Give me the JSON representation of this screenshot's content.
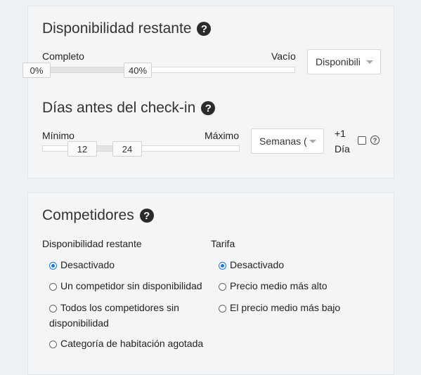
{
  "availability": {
    "title": "Disponibilidad restante",
    "left_label": "Completo",
    "right_label": "Vacío",
    "min_value": "0%",
    "max_value": "40%",
    "range_start_fraction": 0.0,
    "range_end_fraction": 0.4,
    "select_value": "Disponibili"
  },
  "days_before": {
    "title": "Días antes del check-in",
    "left_label": "Mínimo",
    "right_label": "Máximo",
    "min_value": "12",
    "max_value": "24",
    "select_value": "Semanas (",
    "plus_day_line1": "+1",
    "plus_day_line2": "Día",
    "plus_day_checked": false
  },
  "competitors": {
    "title": "Competidores",
    "availability_group": {
      "label": "Disponibilidad restante",
      "options": [
        {
          "text": "Desactivado",
          "checked": true
        },
        {
          "text": "Un competidor sin disponibilidad",
          "checked": false
        },
        {
          "text": "Todos los competidores sin",
          "text2": "disponibilidad",
          "checked": false
        },
        {
          "text": "Categoría de habitación agotada",
          "checked": false
        }
      ]
    },
    "rate_group": {
      "label": "Tarifa",
      "options": [
        {
          "text": "Desactivado",
          "checked": true
        },
        {
          "text": "Precio medio más alto",
          "checked": false
        },
        {
          "text": "El precio medio más bajo",
          "checked": false
        }
      ]
    }
  },
  "icons": {
    "help": "question-circle-icon"
  },
  "colors": {
    "accent": "#1a73e8",
    "panel_bg": "#f4f5f6",
    "page_bg": "#eef2f5"
  }
}
